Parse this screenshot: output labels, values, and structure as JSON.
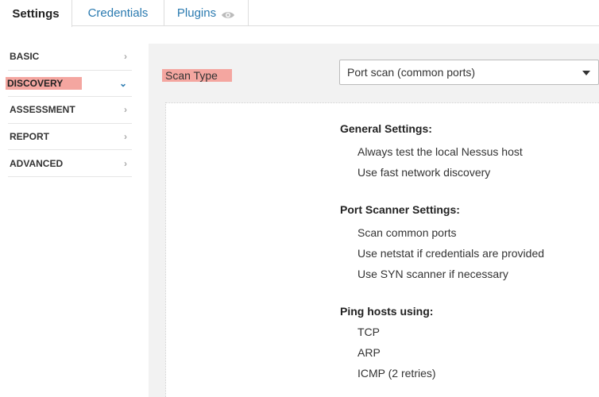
{
  "tabs": [
    {
      "label": "Settings"
    },
    {
      "label": "Credentials"
    },
    {
      "label": "Plugins"
    }
  ],
  "sidebar": {
    "items": [
      {
        "label": "BASIC"
      },
      {
        "label": "DISCOVERY"
      },
      {
        "label": "ASSESSMENT"
      },
      {
        "label": "REPORT"
      },
      {
        "label": "ADVANCED"
      }
    ]
  },
  "scan": {
    "label": "Scan Type",
    "selected": "Port scan (common ports)"
  },
  "sections": [
    {
      "title": "General Settings:",
      "items": [
        "Always test the local Nessus host",
        "Use fast network discovery"
      ]
    },
    {
      "title": "Port Scanner Settings:",
      "items": [
        "Scan common ports",
        "Use netstat if credentials are provided",
        "Use SYN scanner if necessary"
      ]
    },
    {
      "title": "Ping hosts using:",
      "items": [
        "TCP",
        "ARP",
        "ICMP (2 retries)"
      ]
    }
  ],
  "colors": {
    "link": "#2a7ab0",
    "highlight": "#f4a6a0",
    "panel_bg": "#f2f2f2"
  }
}
